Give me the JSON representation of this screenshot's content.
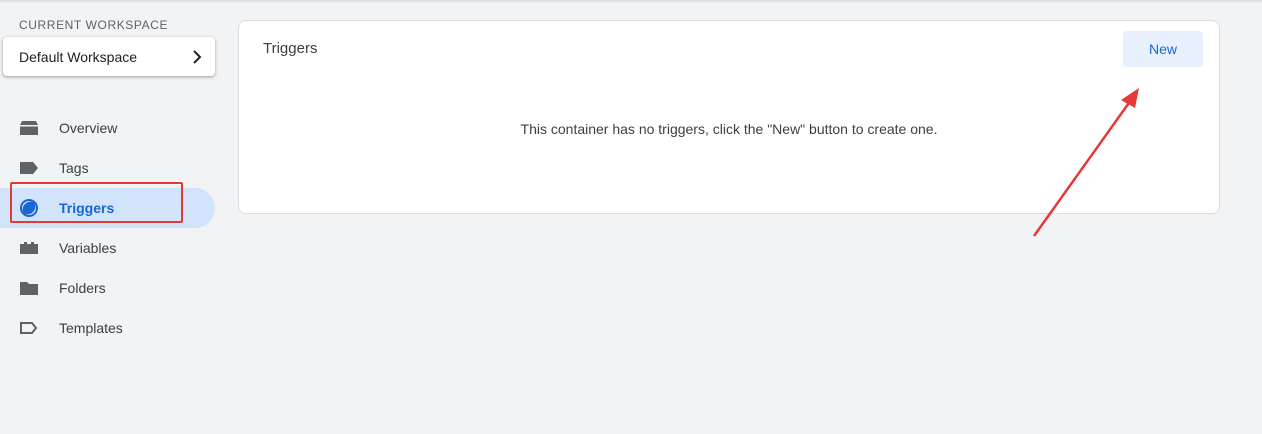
{
  "workspace": {
    "label": "CURRENT WORKSPACE",
    "name": "Default Workspace"
  },
  "sidebar": {
    "items": [
      {
        "label": "Overview",
        "icon": "overview-icon"
      },
      {
        "label": "Tags",
        "icon": "tag-icon"
      },
      {
        "label": "Triggers",
        "icon": "trigger-icon",
        "active": true
      },
      {
        "label": "Variables",
        "icon": "variables-icon"
      },
      {
        "label": "Folders",
        "icon": "folder-icon"
      },
      {
        "label": "Templates",
        "icon": "template-icon"
      }
    ]
  },
  "main": {
    "title": "Triggers",
    "new_button": "New",
    "empty_message": "This container has no triggers, click the \"New\" button to create one."
  },
  "colors": {
    "accent": "#1967d2",
    "active_bg": "#d2e3fc",
    "annotation": "#e53935"
  }
}
